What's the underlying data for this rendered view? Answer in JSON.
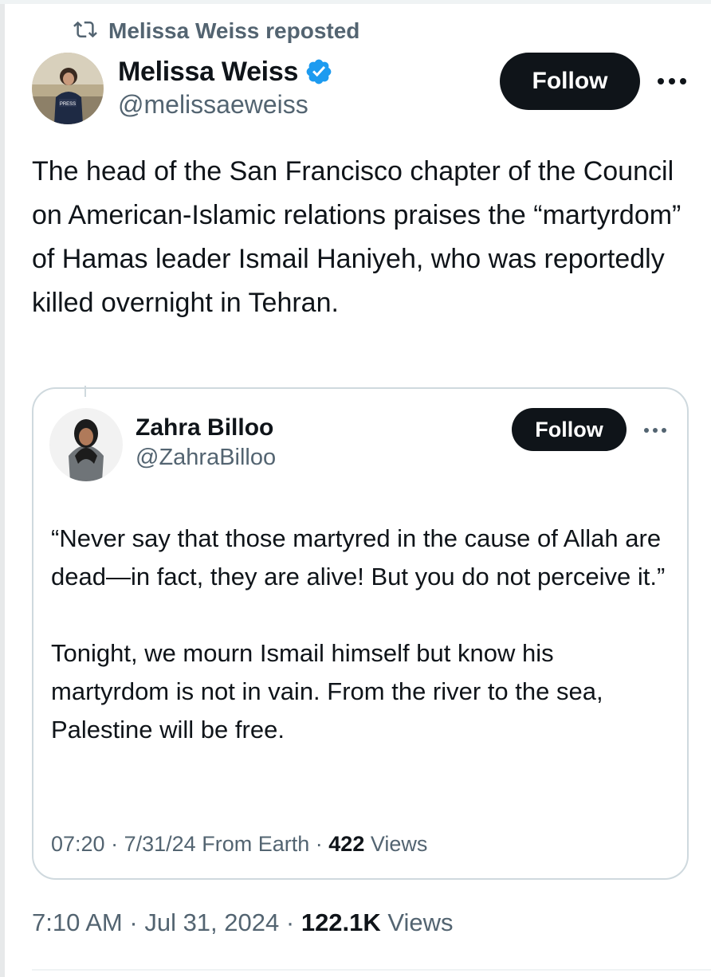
{
  "repost": {
    "label": "Melissa Weiss reposted",
    "icon": "repost-icon"
  },
  "tweet": {
    "author_name": "Melissa Weiss",
    "author_handle": "@melissaeweiss",
    "verified": true,
    "follow_label": "Follow",
    "text": "The head of the San Francisco chapter of the Council on American-Islamic relations praises the “martyrdom” of Hamas leader Ismail Haniyeh, who was reportedly killed overnight in Tehran.",
    "time": "7:10 AM",
    "date": "Jul 31, 2024",
    "separator": "·",
    "views_count": "122.1K",
    "views_label": "Views"
  },
  "quote": {
    "author_name": "Zahra Billoo",
    "author_handle": "@ZahraBilloo",
    "follow_label": "Follow",
    "text": "“Never say that those martyred in the cause of Allah are dead—in fact, they are alive! But you do not perceive it.”\n\nTonight, we mourn Ismail himself but know his martyrdom is not in vain. From the river to the sea, Palestine will be free.",
    "time": "07:20",
    "date": "7/31/24",
    "source": "From Earth",
    "separator": "·",
    "views_count": "422",
    "views_label": "Views"
  },
  "colors": {
    "text_primary": "#0f1419",
    "text_secondary": "#536471",
    "verified_blue": "#1d9bf0",
    "button_dark": "#0f1419",
    "border": "#cfd9de"
  }
}
